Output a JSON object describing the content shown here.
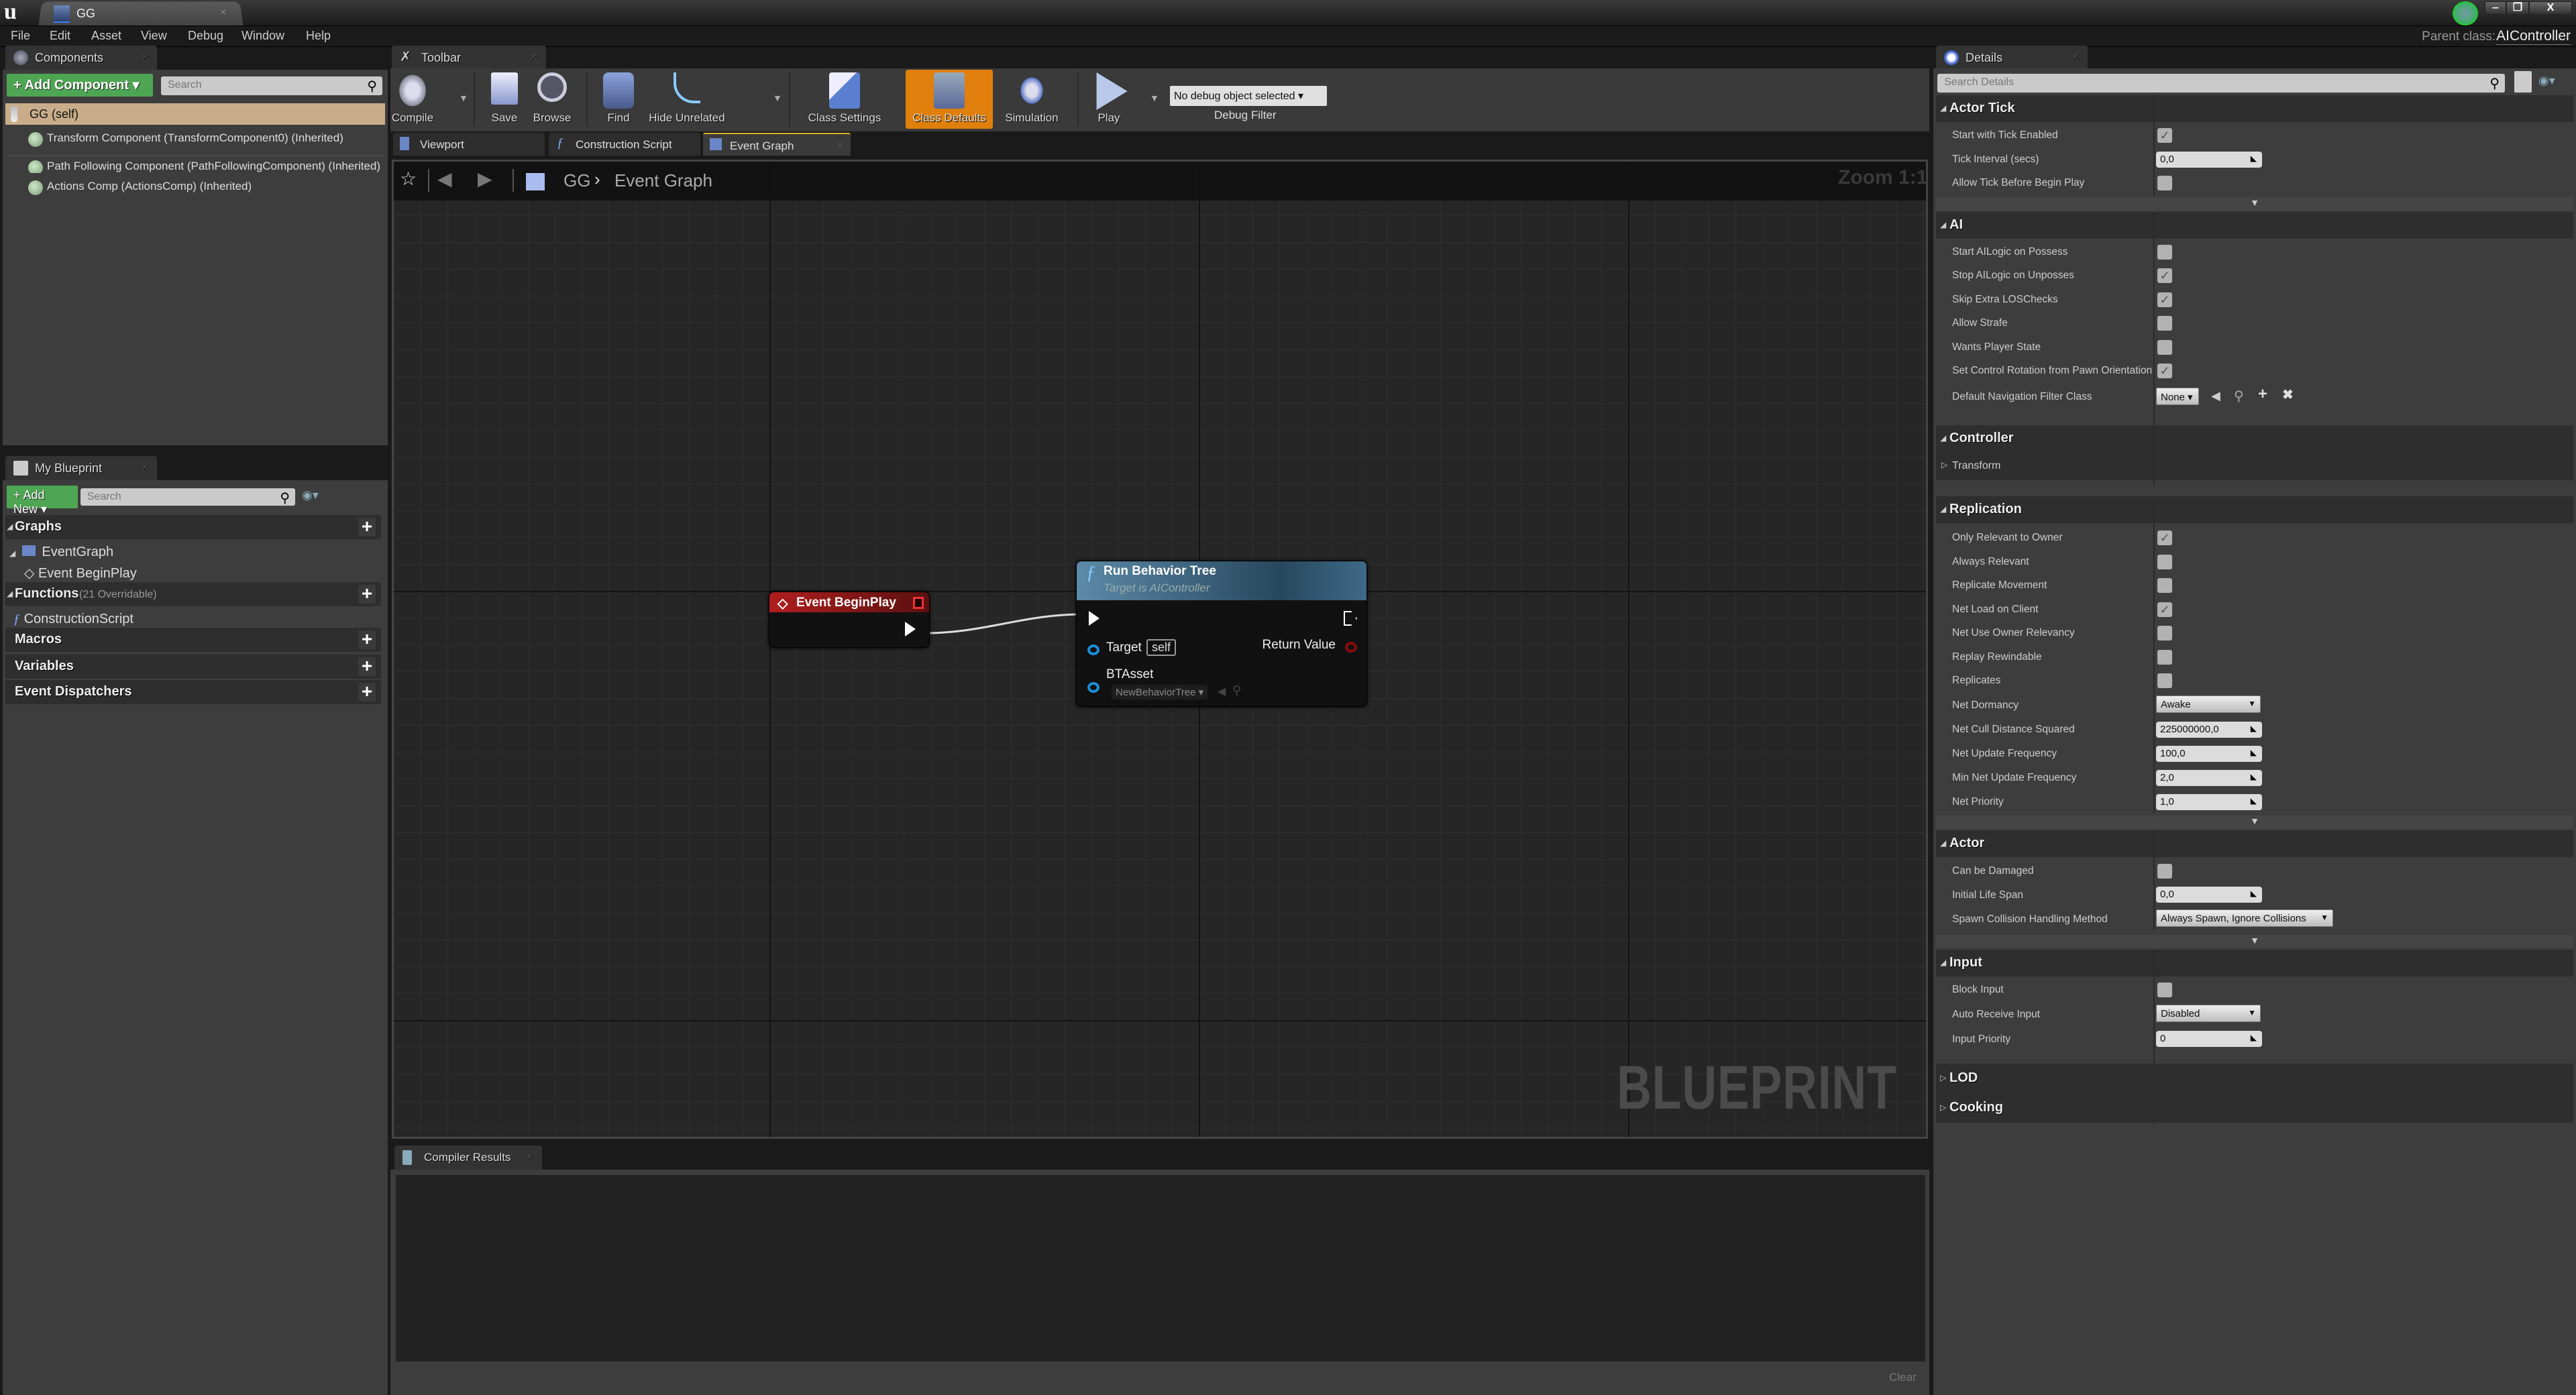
{
  "window": {
    "document_tab": "GG",
    "menu": [
      "File",
      "Edit",
      "Asset",
      "View",
      "Debug",
      "Window",
      "Help"
    ],
    "parent_class_label": "Parent class:",
    "parent_class_value": "AIController",
    "window_buttons": {
      "minimize": "‒",
      "restore": "❐",
      "close": "X"
    }
  },
  "components": {
    "tab_label": "Components",
    "add_button": "+ Add Component ▾",
    "search_placeholder": "Search",
    "root_item": "GG (self)",
    "items": [
      "Transform Component (TransformComponent0) (Inherited)",
      "Path Following Component (PathFollowingComponent) (Inherited)",
      "Actions Comp (ActionsComp) (Inherited)"
    ]
  },
  "my_blueprint": {
    "tab_label": "My Blueprint",
    "add_button": "+ Add New ▾",
    "search_placeholder": "Search",
    "categories": {
      "graphs": "Graphs",
      "event_graph": "EventGraph",
      "event_beginplay": "Event BeginPlay",
      "functions": "Functions",
      "functions_note": "(21 Overridable)",
      "construction_script": "ConstructionScript",
      "macros": "Macros",
      "variables": "Variables",
      "event_dispatchers": "Event Dispatchers"
    }
  },
  "toolbar": {
    "tab_label": "Toolbar",
    "buttons": {
      "compile": "Compile",
      "save": "Save",
      "browse": "Browse",
      "find": "Find",
      "hide_unrelated": "Hide Unrelated",
      "class_settings": "Class Settings",
      "class_defaults": "Class Defaults",
      "simulation": "Simulation",
      "play": "Play"
    },
    "debug_select": "No debug object selected ▾",
    "debug_filter_label": "Debug Filter",
    "active_color": "#e07f0b"
  },
  "graph_tabs": [
    "Viewport",
    "Construction Script",
    "Event Graph"
  ],
  "graph": {
    "breadcrumb_root": "GG",
    "breadcrumb_sep": "›",
    "breadcrumb_current": "Event Graph",
    "zoom": "Zoom 1:1",
    "watermark": "BLUEPRINT",
    "nodes": {
      "begin_play": {
        "title": "Event BeginPlay"
      },
      "run_behavior_tree": {
        "title": "Run Behavior Tree",
        "subtitle": "Target is AIController",
        "target_label": "Target",
        "target_value": "self",
        "return_label": "Return Value",
        "btasset_label": "BTAsset",
        "btasset_value": "NewBehaviorTree ▾"
      }
    }
  },
  "compiler": {
    "tab_label": "Compiler Results",
    "clear_button": "Clear"
  },
  "details": {
    "tab_label": "Details",
    "search_placeholder": "Search Details",
    "sections": {
      "actor_tick": {
        "title": "Actor Tick",
        "start_with_tick": {
          "label": "Start with Tick Enabled",
          "checked": true
        },
        "tick_interval": {
          "label": "Tick Interval (secs)",
          "value": "0,0"
        },
        "allow_tick_before": {
          "label": "Allow Tick Before Begin Play",
          "checked": false
        }
      },
      "ai": {
        "title": "AI",
        "start_ai_logic": {
          "label": "Start AILogic on Possess",
          "checked": false
        },
        "stop_ai_logic": {
          "label": "Stop AILogic on Unposses",
          "checked": true
        },
        "skip_los": {
          "label": "Skip Extra LOSChecks",
          "checked": true
        },
        "allow_strafe": {
          "label": "Allow Strafe",
          "checked": false
        },
        "wants_player_state": {
          "label": "Wants Player State",
          "checked": false
        },
        "set_control_rotation": {
          "label": "Set Control Rotation from Pawn Orientation",
          "checked": true
        },
        "nav_filter": {
          "label": "Default Navigation Filter Class",
          "value": "None ▾"
        }
      },
      "controller": {
        "title": "Controller",
        "transform": "Transform"
      },
      "replication": {
        "title": "Replication",
        "only_relevant_owner": {
          "label": "Only Relevant to Owner",
          "checked": true
        },
        "always_relevant": {
          "label": "Always Relevant",
          "checked": false
        },
        "replicate_movement": {
          "label": "Replicate Movement",
          "checked": false
        },
        "net_load_client": {
          "label": "Net Load on Client",
          "checked": true
        },
        "net_use_owner_relevancy": {
          "label": "Net Use Owner Relevancy",
          "checked": false
        },
        "replay_rewindable": {
          "label": "Replay Rewindable",
          "checked": false
        },
        "replicates": {
          "label": "Replicates",
          "checked": false
        },
        "net_dormancy": {
          "label": "Net Dormancy",
          "value": "Awake"
        },
        "net_cull_distance": {
          "label": "Net Cull Distance Squared",
          "value": "225000000,0"
        },
        "net_update_frequency": {
          "label": "Net Update Frequency",
          "value": "100,0"
        },
        "min_net_update_frequency": {
          "label": "Min Net Update Frequency",
          "value": "2,0"
        },
        "net_priority": {
          "label": "Net Priority",
          "value": "1,0"
        }
      },
      "actor": {
        "title": "Actor",
        "can_be_damaged": {
          "label": "Can be Damaged",
          "checked": false
        },
        "initial_life_span": {
          "label": "Initial Life Span",
          "value": "0,0"
        },
        "spawn_collision": {
          "label": "Spawn Collision Handling Method",
          "value": "Always Spawn, Ignore Collisions"
        }
      },
      "input": {
        "title": "Input",
        "block_input": {
          "label": "Block Input",
          "checked": false
        },
        "auto_receive_input": {
          "label": "Auto Receive Input",
          "value": "Disabled"
        },
        "input_priority": {
          "label": "Input Priority",
          "value": "0"
        }
      },
      "lod": {
        "title": "LOD"
      },
      "cooking": {
        "title": "Cooking"
      }
    }
  }
}
